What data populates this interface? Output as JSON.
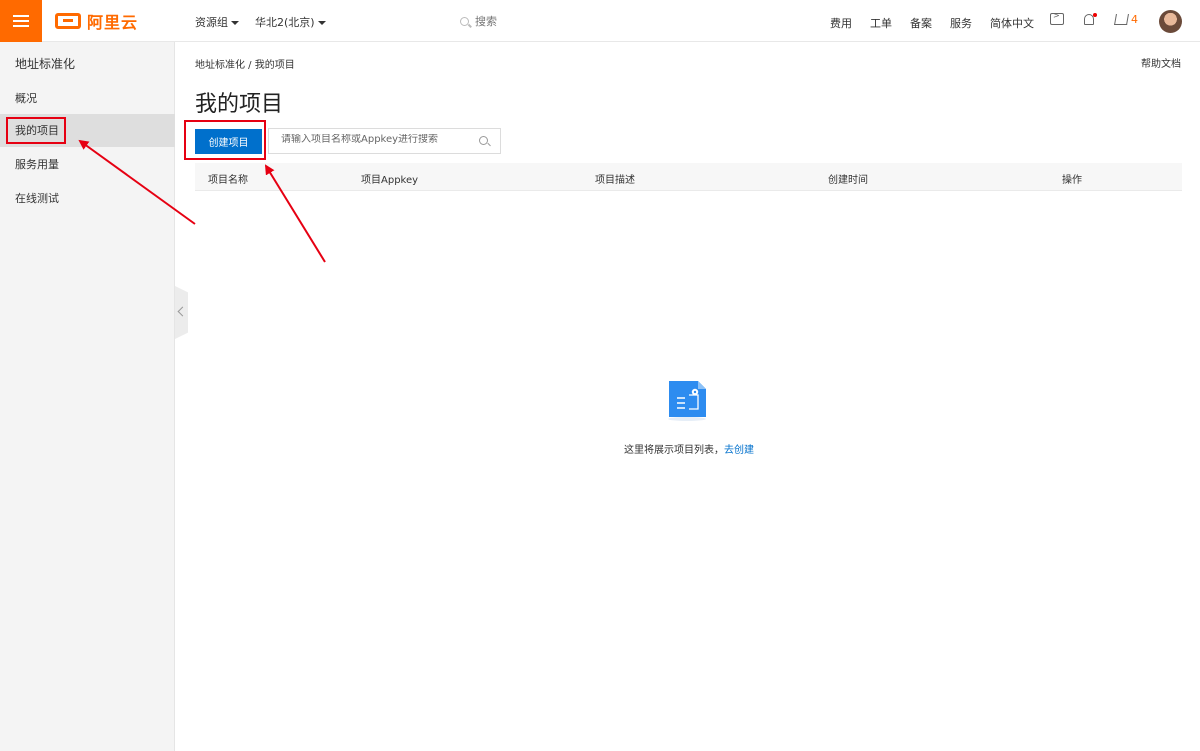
{
  "header": {
    "logo_text": "阿里云",
    "resource_group": "资源组",
    "region": "华北2(北京)",
    "search_placeholder": "搜索",
    "links": [
      "费用",
      "工单",
      "备案",
      "服务",
      "简体中文"
    ],
    "cart_count": "4"
  },
  "sidebar": {
    "title": "地址标准化",
    "items": [
      {
        "label": "概况",
        "active": false
      },
      {
        "label": "我的项目",
        "active": true
      },
      {
        "label": "服务用量",
        "active": false
      },
      {
        "label": "在线测试",
        "active": false
      }
    ]
  },
  "main": {
    "breadcrumb": "地址标准化 / 我的项目",
    "help": "帮助文档",
    "title": "我的项目",
    "create_button": "创建项目",
    "search_placeholder": "请输入项目名称或Appkey进行搜索",
    "columns": [
      "项目名称",
      "项目Appkey",
      "项目描述",
      "创建时间",
      "操作"
    ],
    "empty_text": "这里将展示项目列表，",
    "empty_link": "去创建"
  },
  "colors": {
    "brand": "#ff6a00",
    "primary": "#0070cc",
    "annotation": "#e60012"
  }
}
